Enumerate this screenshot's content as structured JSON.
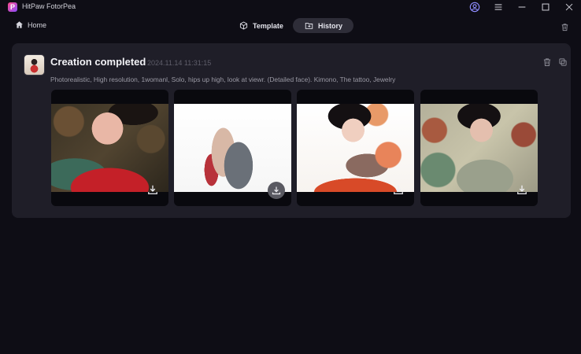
{
  "app": {
    "title": "HitPaw FotorPea",
    "logo_letter": "P"
  },
  "titlebar": {
    "icons": [
      "account-icon",
      "menu-icon",
      "minimize-icon",
      "maximize-icon",
      "close-icon"
    ]
  },
  "nav": {
    "home_label": "Home",
    "tabs": [
      {
        "label": "Template",
        "icon": "cube-icon",
        "active": false
      },
      {
        "label": "History",
        "icon": "folder-icon",
        "active": true
      }
    ]
  },
  "card": {
    "title": "Creation completed",
    "timestamp": "2024.11.14 11:31:15",
    "prompt": "Photorealistic, High resolution, 1womanl, Solo, hips up high, look at viewr. (Detailed face). Kimono, The tattoo, Jewelry",
    "images": [
      {
        "icon": "download-icon"
      },
      {
        "icon": "download-icon"
      },
      {
        "icon": "download-icon"
      },
      {
        "icon": "download-icon"
      }
    ]
  },
  "colors": {
    "background": "#0e0d15",
    "card": "#1f1e28",
    "active_tab": "#2e2d38"
  }
}
